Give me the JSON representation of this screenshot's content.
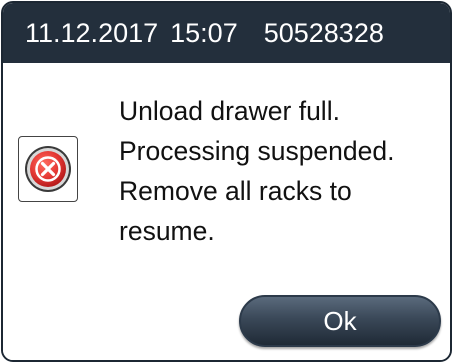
{
  "header": {
    "date": "11.12.2017",
    "time": "15:07",
    "id": "50528328"
  },
  "dialog": {
    "icon": "error-x-icon",
    "message_lines": [
      "Unload drawer full.",
      "Processing suspended.",
      "Remove all racks to",
      "resume."
    ],
    "ok_label": "Ok"
  },
  "colors": {
    "header_bg": "#232f3c",
    "error_red": "#e53935",
    "button_dark": "#2c3a4a"
  }
}
